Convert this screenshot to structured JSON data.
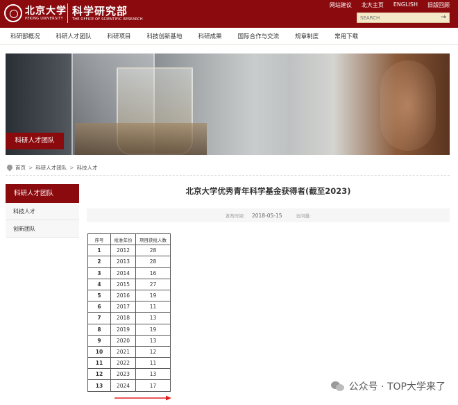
{
  "header": {
    "logo_cn": "北京大学",
    "logo_en": "PEKING UNIVERSITY",
    "dept_cn": "科学研究部",
    "dept_en": "THE OFFICE OF SCIENTIFIC RESEARCH",
    "top_links": [
      "网站建议",
      "北大主页",
      "ENGLISH",
      "旧版回顾"
    ],
    "search_placeholder": "SEARCH",
    "brand_color": "#8b0a0e"
  },
  "nav": {
    "items": [
      "科研部概况",
      "科研人才团队",
      "科研项目",
      "科技创新基地",
      "科研成果",
      "国际合作与交流",
      "规章制度",
      "常用下载"
    ]
  },
  "banner": {
    "label": "科研人才团队"
  },
  "breadcrumb": {
    "items": [
      "首页",
      "科研人才团队",
      "科技人才"
    ],
    "separator": ">"
  },
  "sidebar": {
    "title": "科研人才团队",
    "items": [
      "科技人才",
      "创新团队"
    ]
  },
  "article": {
    "title": "北京大学优秀青年科学基金获得者(截至2023)",
    "published_label": "发布时间:",
    "published_date": "2018-05-15",
    "views_label": "访问量:"
  },
  "table": {
    "headers": [
      "序号",
      "批准年份",
      "项目获批人数"
    ],
    "rows": [
      [
        "1",
        "2012",
        "28"
      ],
      [
        "2",
        "2013",
        "28"
      ],
      [
        "3",
        "2014",
        "16"
      ],
      [
        "4",
        "2015",
        "27"
      ],
      [
        "5",
        "2016",
        "19"
      ],
      [
        "6",
        "2017",
        "11"
      ],
      [
        "7",
        "2018",
        "13"
      ],
      [
        "8",
        "2019",
        "19"
      ],
      [
        "9",
        "2020",
        "13"
      ],
      [
        "10",
        "2021",
        "12"
      ],
      [
        "11",
        "2022",
        "11"
      ],
      [
        "12",
        "2023",
        "13"
      ],
      [
        "13",
        "2024",
        "17"
      ]
    ]
  },
  "watermark": {
    "text": "公众号 · TOP大学来了",
    "icon": "wechat-icon"
  }
}
